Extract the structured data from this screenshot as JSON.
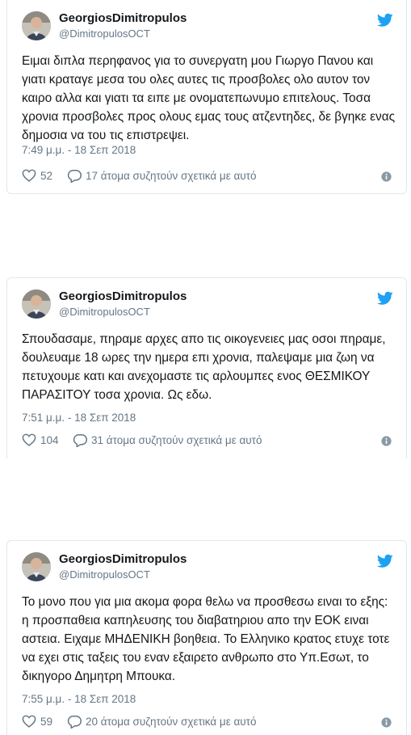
{
  "tweets": [
    {
      "name": "GeorgiosDimitropulos",
      "handle": "@DimitropulosOCT",
      "text": "Ειμαι διπλα περηφανος για το συνεργατη μου Γιωργο Πανου και γιατι κραταγε μεσα του ολες αυτες τις προσβολες ολο αυτον τον καιρο αλλα και γιατι τα ειπε με ονοματεπωνυμο επιτελους. Τοσα χρονια προσβολες προς ολους εμας τους ατζεντηδες, δε βγηκε ενας δημοσια να του τις επιστρεψει.",
      "time": "7:49 μ.μ. - 18 Σεπ 2018",
      "likes": "52",
      "replies": "17 άτομα συζητούν σχετικά με αυτό"
    },
    {
      "name": "GeorgiosDimitropulos",
      "handle": "@DimitropulosOCT",
      "text": "Σπουδασαμε, πηραμε αρχες απο τις οικογενειες μας οσοι πηραμε, δουλευαμε 18 ωρες την ημερα επι χρονια, παλεψαμε μια ζωη να πετυχουμε κατι και ανεχομαστε τις αρλουμπες ενος ΘΕΣΜΙΚΟΥ ΠΑΡΑΣΙΤΟΥ τοσα χρονια. Ως εδω.",
      "time": "7:51 μ.μ. - 18 Σεπ 2018",
      "likes": "104",
      "replies": "31 άτομα συζητούν σχετικά με αυτό"
    },
    {
      "name": "GeorgiosDimitropulos",
      "handle": "@DimitropulosOCT",
      "text": "Το μονο που για μια ακομα φορα θελω να προσθεσω ειναι το εξης: η προσπαθεια καπηλευσης του διαβατηριου απο την ΕΟΚ ειναι αστεια. Ειχαμε ΜΗΔΕΝΙΚΗ βοηθεια. Το Ελληνικο κρατος ετυχε τοτε να εχει στις ταξεις του εναν εξαιρετο ανθρωπο στο Υπ.Εσωτ, το δικηγορο Δημητρη Μπουκα.",
      "time": "7:55 μ.μ. - 18 Σεπ 2018",
      "likes": "59",
      "replies": "20 άτομα συζητούν σχετικά με αυτό"
    }
  ],
  "colors": {
    "twitter_blue": "#1da1f2",
    "text": "#14171a",
    "muted": "#657786",
    "border": "#e1e8ed"
  }
}
